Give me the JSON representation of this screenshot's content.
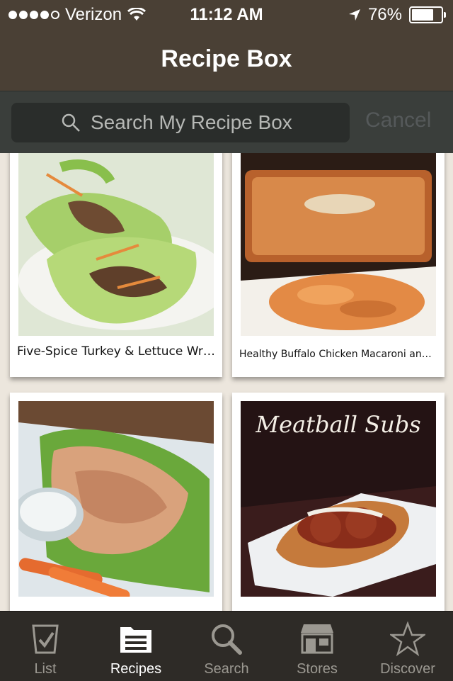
{
  "status_bar": {
    "carrier": "Verizon",
    "time": "11:12 AM",
    "battery": "76%",
    "battery_level": 0.76,
    "signal_bars_filled": 4,
    "signal_bars_total": 5
  },
  "nav": {
    "title": "Recipe Box"
  },
  "search": {
    "placeholder": "Search My Recipe Box",
    "cancel_label": "Cancel"
  },
  "recipes": [
    {
      "title": "Five-Spice Turkey & Lettuce Wraps"
    },
    {
      "title": "Healthy Buffalo Chicken Macaroni and Ch..."
    },
    {
      "title": ""
    },
    {
      "title": "",
      "image_text": "Meatball Subs"
    }
  ],
  "tabs": [
    {
      "label": "List",
      "icon": "list-check-icon",
      "active": false
    },
    {
      "label": "Recipes",
      "icon": "recipe-card-icon",
      "active": true
    },
    {
      "label": "Search",
      "icon": "search-icon",
      "active": false
    },
    {
      "label": "Stores",
      "icon": "store-icon",
      "active": false
    },
    {
      "label": "Discover",
      "icon": "star-icon",
      "active": false
    }
  ],
  "colors": {
    "header": "#4a4035",
    "search_bar": "#3a3e3b",
    "tab_bar": "#2e2b27",
    "background": "#ece6dd"
  }
}
